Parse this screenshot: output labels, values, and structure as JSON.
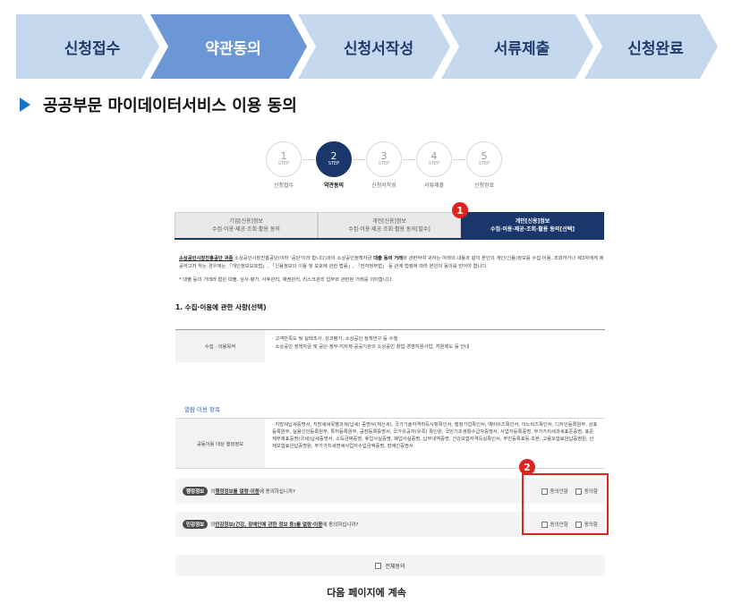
{
  "top_steps": [
    "신청접수",
    "약관동의",
    "신청서작성",
    "서류제출",
    "신청완료"
  ],
  "section_title": "공공부문 마이데이터서비스 이용 동의",
  "progress": {
    "step_label": "STEP",
    "steps": [
      {
        "num": "1",
        "caption": "신청접수"
      },
      {
        "num": "2",
        "caption": "약관동의"
      },
      {
        "num": "3",
        "caption": "신청서작성"
      },
      {
        "num": "4",
        "caption": "서류제출"
      },
      {
        "num": "5",
        "caption": "신청완료"
      }
    ]
  },
  "tabs": [
    {
      "line1": "기업[신용]정보",
      "line2": "수집·이용·제공·조회·활용 동의"
    },
    {
      "line1": "개인[신용]정보",
      "line2": "수집·이용·제공·조회·활용 동의[필수]"
    },
    {
      "line1": "개인[신용]정보",
      "line2": "수집·이용·제공·조회·활용 동의[선택]"
    }
  ],
  "badges": {
    "one": "1",
    "two": "2"
  },
  "notice": {
    "org": "소상공인시장진흥공단 귀중",
    "text1": " 소상공인시장진흥공단(이하 '공단'이라 합니다)과의 소상공인정책자금 ",
    "bold1": "대출 등의 거래",
    "text2": "와 관련하여 귀하는 아래의 내용과 같이 본인의 개인(신용)정보를 수집·이용, 조회하거나 제3자에게 제공하고자 하는 경우에는 「개인정보보호법」, 「신용정보의 이용 및 보호에 관한 법률」, 「전자정부법」 등 관계 법령에 따라 본인의 동의를 얻어야 합니다.",
    "note": "* 대출 등의 거래라 함은 대출, 심사·평가, 사후관리, 채권관리, 리스크관리 업무와 관련된 거래를 의미합니다."
  },
  "section1_title": "1. 수집·이용에 관한 사항(선택)",
  "purpose": {
    "label": "수집 · 이용목적",
    "line1": "· 고객만족도 및 실태조사, 성과평가, 소상공인 정책연구 등 수행",
    "line2": "· 소상공인 정책자금 및 공단·정부·지자체·공공기관의 소상공인 창업·경영지원사업, 지원제도 등 안내"
  },
  "view_head": "열람·이용 항목",
  "admin_info": {
    "label": "공동이용 대상 행정정보",
    "text": "· 지방세납세증명서, 지방세세목별과세(납세) 증명서(재산세), 국가기술자격취득사항확인서, 행정기업확인서, 예비비즈확인서, 이노비즈확인서, 디자인등록원부, 상표등록원부, 실용신안등록원부, 특허등록원부, 공장등록증명서, 국가유공자(유족) 확인원, 국민기초생활수급자증명서, 사업자등록증명, 부가가치세과세표준증명, 표준재무제표증명(국세)납세증명서, 소득금액증명, 휴업사실증명, 폐업사실증명, 납부내역증명, 건강보험자격득실확인서, 주민등록표등·초본, 고용보험료완납증명원, 산재보험료완납증명원, 부가가치세면세사업자수입금액증명, 장애인증명서"
  },
  "consent1": {
    "tag": "행정정보",
    "pre": " 의 ",
    "link": "행정정보를 열람·이용",
    "post": "에 동의하십니까?",
    "disagree": "동의안함",
    "agree": "동의함"
  },
  "consent2": {
    "tag": "민감정보",
    "pre": " 의 ",
    "link": "민감정보(건강, 장애인에 관한 정보 등)를 열람·이용",
    "post": "에 동의하십니까?",
    "disagree": "동의안함",
    "agree": "동의함"
  },
  "all_agree": "전체동의",
  "continue_text": "다음 페이지에 계속",
  "colors": {
    "accent_navy": "#19376b",
    "chevron_active": "#6b97d6",
    "chevron": "#c5d8ee",
    "highlight_red": "#e0231f"
  }
}
